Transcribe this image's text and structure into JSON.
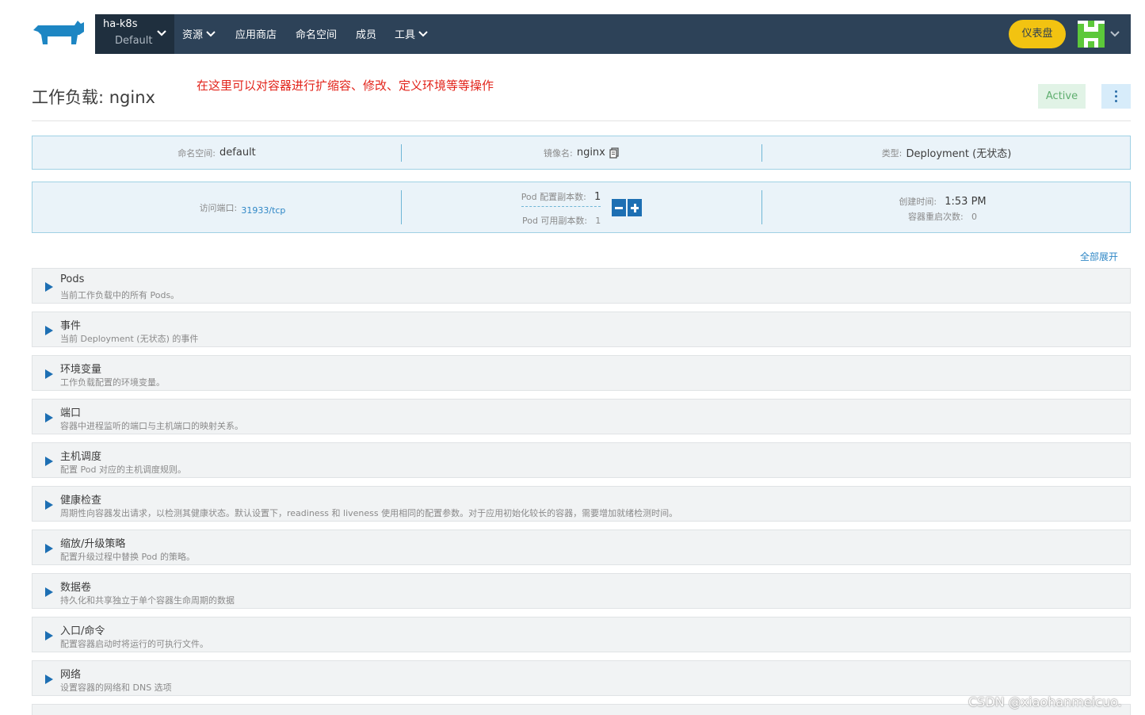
{
  "header": {
    "logo_icon": "rancher-cow-logo-icon",
    "cluster_name": "ha-k8s",
    "project_name": "Default",
    "nav": [
      {
        "label": "资源",
        "has_dropdown": true
      },
      {
        "label": "应用商店",
        "has_dropdown": false
      },
      {
        "label": "命名空间",
        "has_dropdown": false
      },
      {
        "label": "成员",
        "has_dropdown": false
      },
      {
        "label": "工具",
        "has_dropdown": true
      }
    ],
    "dashboard_label": "仪表盘",
    "accent_color": "#f2c311",
    "nav_bg_color": "#2d4258"
  },
  "page": {
    "title": "工作负载: nginx",
    "annotation": "在这里可以对容器进行扩缩容、修改、定义环境等等操作",
    "state": "Active",
    "more_icon": "kebab-menu-icon"
  },
  "info_row1": {
    "namespace_label": "命名空间:",
    "namespace_value": "default",
    "image_label": "镜像名:",
    "image_value": "nginx",
    "copy_icon": "copy-icon",
    "type_label": "类型:",
    "type_value": "Deployment (无状态)"
  },
  "info_row2": {
    "port_label": "访问端口:",
    "port_value": "31933/tcp",
    "replicas_config_label": "Pod 配置副本数:",
    "replicas_config_value": "1",
    "replicas_available_label": "Pod 可用副本数:",
    "replicas_available_value": "1",
    "created_label": "创建时间:",
    "created_value": "1:53 PM",
    "restarts_label": "容器重启次数:",
    "restarts_value": "0"
  },
  "expand_all_label": "全部展开",
  "sections": [
    {
      "title": "Pods",
      "desc": "当前工作负载中的所有 Pods。"
    },
    {
      "title": "事件",
      "desc": "当前 Deployment (无状态) 的事件"
    },
    {
      "title": "环境变量",
      "desc": "工作负载配置的环境变量。"
    },
    {
      "title": "端口",
      "desc": "容器中进程监听的端口与主机端口的映射关系。"
    },
    {
      "title": "主机调度",
      "desc": "配置 Pod 对应的主机调度规则。"
    },
    {
      "title": "健康检查",
      "desc": "周期性向容器发出请求，以检测其健康状态。默认设置下，readiness 和 liveness 使用相同的配置参数。对于应用初始化较长的容器，需要增加就绪检测时间。"
    },
    {
      "title": "缩放/升级策略",
      "desc": "配置升级过程中替换 Pod 的策略。"
    },
    {
      "title": "数据卷",
      "desc": "持久化和共享独立于单个容器生命周期的数据"
    },
    {
      "title": "入口/命令",
      "desc": "配置容器启动时将运行的可执行文件。"
    },
    {
      "title": "网络",
      "desc": "设置容器的网络和 DNS 选项"
    }
  ],
  "watermark": "CSDN @xiaohanmeicuo."
}
